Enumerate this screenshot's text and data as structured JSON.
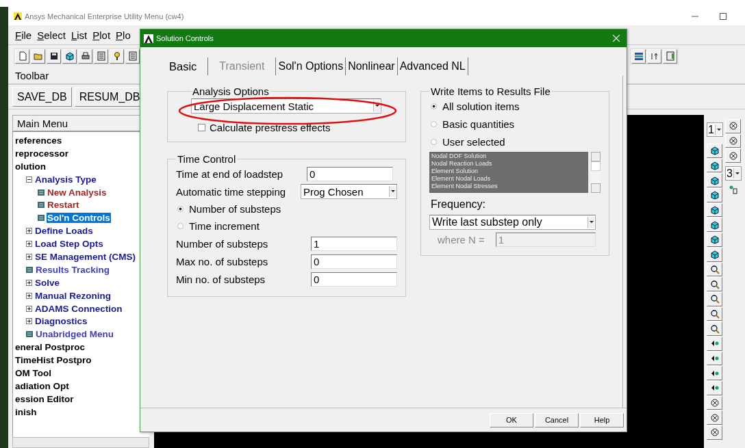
{
  "window": {
    "title": "Ansys Mechanical Enterprise Utility Menu (cw4)"
  },
  "menu_bar": [
    "File",
    "Select",
    "List",
    "Plot",
    "Plo"
  ],
  "toolbar": {
    "title": "Toolbar",
    "buttons": [
      "SAVE_DB",
      "RESUM_DB"
    ]
  },
  "main_menu": {
    "title": "Main Menu",
    "items": [
      {
        "label": "references",
        "kind": "top",
        "selected": false
      },
      {
        "label": "reprocessor",
        "kind": "top",
        "selected": false
      },
      {
        "label": "olution",
        "kind": "top",
        "selected": false,
        "children": [
          {
            "label": "Analysis Type",
            "kind": "folder",
            "expanded": true,
            "selected": false,
            "children": [
              {
                "label": "New Analysis",
                "kind": "dialog",
                "selected": false
              },
              {
                "label": "Restart",
                "kind": "dialog",
                "selected": false
              },
              {
                "label": "Sol'n Controls",
                "kind": "dialog",
                "selected": true
              }
            ]
          },
          {
            "label": "Define Loads",
            "kind": "folder",
            "expanded": false,
            "selected": false
          },
          {
            "label": "Load Step Opts",
            "kind": "folder",
            "expanded": false,
            "selected": false
          },
          {
            "label": "SE Management (CMS)",
            "kind": "folder",
            "expanded": false,
            "selected": false
          },
          {
            "label": "Results Tracking",
            "kind": "command",
            "selected": false
          },
          {
            "label": "Solve",
            "kind": "folder",
            "expanded": false,
            "selected": false
          },
          {
            "label": "Manual Rezoning",
            "kind": "folder",
            "expanded": false,
            "selected": false
          },
          {
            "label": "ADAMS Connection",
            "kind": "folder",
            "expanded": false,
            "selected": false
          },
          {
            "label": "Diagnostics",
            "kind": "folder",
            "expanded": false,
            "selected": false
          },
          {
            "label": "Unabridged Menu",
            "kind": "command",
            "selected": false
          }
        ]
      },
      {
        "label": "eneral Postproc",
        "kind": "top",
        "selected": false
      },
      {
        "label": "TimeHist Postpro",
        "kind": "top",
        "selected": false
      },
      {
        "label": "OM Tool",
        "kind": "top",
        "selected": false
      },
      {
        "label": "adiation Opt",
        "kind": "top",
        "selected": false
      },
      {
        "label": "ession Editor",
        "kind": "top",
        "selected": false
      },
      {
        "label": "inish",
        "kind": "top",
        "selected": false
      }
    ]
  },
  "view_panel": {
    "window_number": "1",
    "view_number": "3"
  },
  "dialog": {
    "title": "Solution Controls",
    "tabs": [
      {
        "label": "Basic",
        "selected": true,
        "disabled": false
      },
      {
        "label": "Transient",
        "selected": false,
        "disabled": true
      },
      {
        "label": "Sol'n Options",
        "selected": false,
        "disabled": false
      },
      {
        "label": "Nonlinear",
        "selected": false,
        "disabled": false
      },
      {
        "label": "Advanced NL",
        "selected": false,
        "disabled": false
      }
    ],
    "analysis_options": {
      "title": "Analysis Options",
      "analysis_type": "Large Displacement Static",
      "prestress": {
        "label": "Calculate prestress effects",
        "checked": false
      }
    },
    "time_control": {
      "title": "Time Control",
      "time_at_end": {
        "label": "Time at end of loadstep",
        "value": "0"
      },
      "auto_time_stepping": {
        "label": "Automatic time stepping",
        "value": "Prog Chosen"
      },
      "step_mode": [
        {
          "label": "Number of substeps",
          "selected": true
        },
        {
          "label": "Time increment",
          "selected": false
        }
      ],
      "fields": [
        {
          "label": "Number of substeps",
          "value": "1"
        },
        {
          "label": "Max no. of substeps",
          "value": "0"
        },
        {
          "label": "Min no. of substeps",
          "value": "0"
        }
      ]
    },
    "write_items": {
      "title": "Write Items to Results File",
      "options": [
        {
          "label": "All solution items",
          "selected": true
        },
        {
          "label": "Basic quantities",
          "selected": false
        },
        {
          "label": "User selected",
          "selected": false
        }
      ],
      "list_disabled": true,
      "items": [
        {
          "label": "Nodal DOF Solution",
          "selected": true
        },
        {
          "label": "Nodal Reaction Loads",
          "selected": true
        },
        {
          "label": "Element Solution",
          "selected": true
        },
        {
          "label": "Element Nodal Loads",
          "selected": true
        },
        {
          "label": "Element Nodal Stresses",
          "selected": true
        }
      ],
      "frequency_label": "Frequency:",
      "frequency": "Write last substep only",
      "where_n": {
        "label": "where N =",
        "value": "1",
        "disabled": true
      }
    },
    "buttons": [
      "OK",
      "Cancel",
      "Help"
    ]
  }
}
